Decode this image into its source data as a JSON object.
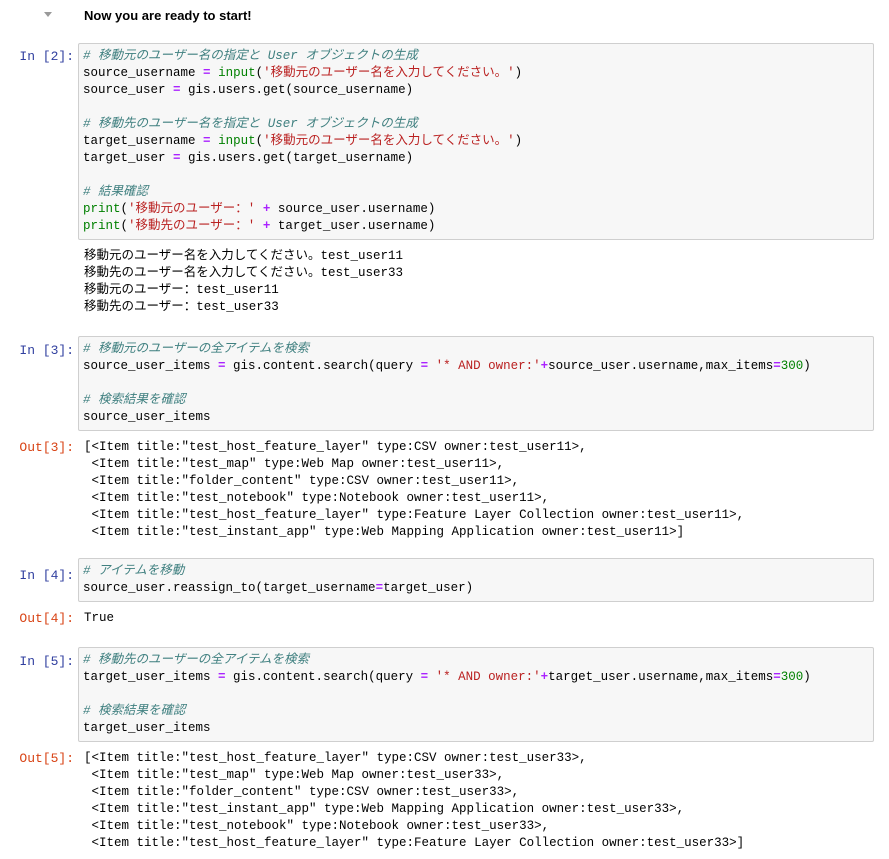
{
  "heading": {
    "title": "Now you are ready to start!"
  },
  "colors": {
    "prompt_in": "#303f9f",
    "prompt_out": "#d84315",
    "comment": "#408080",
    "string": "#ba2121",
    "builtin": "#008000",
    "operator": "#aa22ff",
    "cell_bg": "#f7f7f7",
    "cell_border": "#cfcfcf"
  },
  "cells": [
    {
      "in_prompt": "In [2]:",
      "code": [
        [
          {
            "t": "comment",
            "v": "# 移動元のユーザー名の指定と User オブジェクトの生成"
          }
        ],
        [
          {
            "t": "plain",
            "v": "source_username "
          },
          {
            "t": "op",
            "v": "="
          },
          {
            "t": "plain",
            "v": " "
          },
          {
            "t": "builtin",
            "v": "input"
          },
          {
            "t": "plain",
            "v": "("
          },
          {
            "t": "string",
            "v": "'移動元のユーザー名を入力してください。'"
          },
          {
            "t": "plain",
            "v": ")"
          }
        ],
        [
          {
            "t": "plain",
            "v": "source_user "
          },
          {
            "t": "op",
            "v": "="
          },
          {
            "t": "plain",
            "v": " gis.users.get(source_username)"
          }
        ],
        [],
        [
          {
            "t": "comment",
            "v": "# 移動先のユーザー名を指定と User オブジェクトの生成"
          }
        ],
        [
          {
            "t": "plain",
            "v": "target_username "
          },
          {
            "t": "op",
            "v": "="
          },
          {
            "t": "plain",
            "v": " "
          },
          {
            "t": "builtin",
            "v": "input"
          },
          {
            "t": "plain",
            "v": "("
          },
          {
            "t": "string",
            "v": "'移動元のユーザー名を入力してください。'"
          },
          {
            "t": "plain",
            "v": ")"
          }
        ],
        [
          {
            "t": "plain",
            "v": "target_user "
          },
          {
            "t": "op",
            "v": "="
          },
          {
            "t": "plain",
            "v": " gis.users.get(target_username)"
          }
        ],
        [],
        [
          {
            "t": "comment",
            "v": "# 結果確認"
          }
        ],
        [
          {
            "t": "builtin",
            "v": "print"
          },
          {
            "t": "plain",
            "v": "("
          },
          {
            "t": "string",
            "v": "'移動元のユーザー：'"
          },
          {
            "t": "plain",
            "v": " "
          },
          {
            "t": "op",
            "v": "+"
          },
          {
            "t": "plain",
            "v": " source_user.username)"
          }
        ],
        [
          {
            "t": "builtin",
            "v": "print"
          },
          {
            "t": "plain",
            "v": "("
          },
          {
            "t": "string",
            "v": "'移動先のユーザー：'"
          },
          {
            "t": "plain",
            "v": " "
          },
          {
            "t": "op",
            "v": "+"
          },
          {
            "t": "plain",
            "v": " target_user.username)"
          }
        ]
      ],
      "out_prompt": "",
      "output": [
        "移動元のユーザー名を入力してください。test_user11",
        "移動先のユーザー名を入力してください。test_user33",
        "移動元のユーザー：test_user11",
        "移動先のユーザー：test_user33"
      ]
    },
    {
      "in_prompt": "In [3]:",
      "code": [
        [
          {
            "t": "comment",
            "v": "# 移動元のユーザーの全アイテムを検索"
          }
        ],
        [
          {
            "t": "plain",
            "v": "source_user_items "
          },
          {
            "t": "op",
            "v": "="
          },
          {
            "t": "plain",
            "v": " gis.content.search(query "
          },
          {
            "t": "op",
            "v": "="
          },
          {
            "t": "plain",
            "v": " "
          },
          {
            "t": "string",
            "v": "'* AND owner:'"
          },
          {
            "t": "op",
            "v": "+"
          },
          {
            "t": "plain",
            "v": "source_user.username,max_items"
          },
          {
            "t": "op",
            "v": "="
          },
          {
            "t": "number",
            "v": "300"
          },
          {
            "t": "plain",
            "v": ")"
          }
        ],
        [],
        [
          {
            "t": "comment",
            "v": "# 検索結果を確認"
          }
        ],
        [
          {
            "t": "plain",
            "v": "source_user_items"
          }
        ]
      ],
      "out_prompt": "Out[3]:",
      "output": [
        "[<Item title:\"test_host_feature_layer\" type:CSV owner:test_user11>,",
        " <Item title:\"test_map\" type:Web Map owner:test_user11>,",
        " <Item title:\"folder_content\" type:CSV owner:test_user11>,",
        " <Item title:\"test_notebook\" type:Notebook owner:test_user11>,",
        " <Item title:\"test_host_feature_layer\" type:Feature Layer Collection owner:test_user11>,",
        " <Item title:\"test_instant_app\" type:Web Mapping Application owner:test_user11>]"
      ]
    },
    {
      "in_prompt": "In [4]:",
      "code": [
        [
          {
            "t": "comment",
            "v": "# アイテムを移動"
          }
        ],
        [
          {
            "t": "plain",
            "v": "source_user.reassign_to(target_username"
          },
          {
            "t": "op",
            "v": "="
          },
          {
            "t": "plain",
            "v": "target_user)"
          }
        ]
      ],
      "out_prompt": "Out[4]:",
      "output": [
        "True"
      ]
    },
    {
      "in_prompt": "In [5]:",
      "code": [
        [
          {
            "t": "comment",
            "v": "# 移動先のユーザーの全アイテムを検索"
          }
        ],
        [
          {
            "t": "plain",
            "v": "target_user_items "
          },
          {
            "t": "op",
            "v": "="
          },
          {
            "t": "plain",
            "v": " gis.content.search(query "
          },
          {
            "t": "op",
            "v": "="
          },
          {
            "t": "plain",
            "v": " "
          },
          {
            "t": "string",
            "v": "'* AND owner:'"
          },
          {
            "t": "op",
            "v": "+"
          },
          {
            "t": "plain",
            "v": "target_user.username,max_items"
          },
          {
            "t": "op",
            "v": "="
          },
          {
            "t": "number",
            "v": "300"
          },
          {
            "t": "plain",
            "v": ")"
          }
        ],
        [],
        [
          {
            "t": "comment",
            "v": "# 検索結果を確認"
          }
        ],
        [
          {
            "t": "plain",
            "v": "target_user_items"
          }
        ]
      ],
      "out_prompt": "Out[5]:",
      "output": [
        "[<Item title:\"test_host_feature_layer\" type:CSV owner:test_user33>,",
        " <Item title:\"test_map\" type:Web Map owner:test_user33>,",
        " <Item title:\"folder_content\" type:CSV owner:test_user33>,",
        " <Item title:\"test_instant_app\" type:Web Mapping Application owner:test_user33>,",
        " <Item title:\"test_notebook\" type:Notebook owner:test_user33>,",
        " <Item title:\"test_host_feature_layer\" type:Feature Layer Collection owner:test_user33>]"
      ]
    }
  ]
}
